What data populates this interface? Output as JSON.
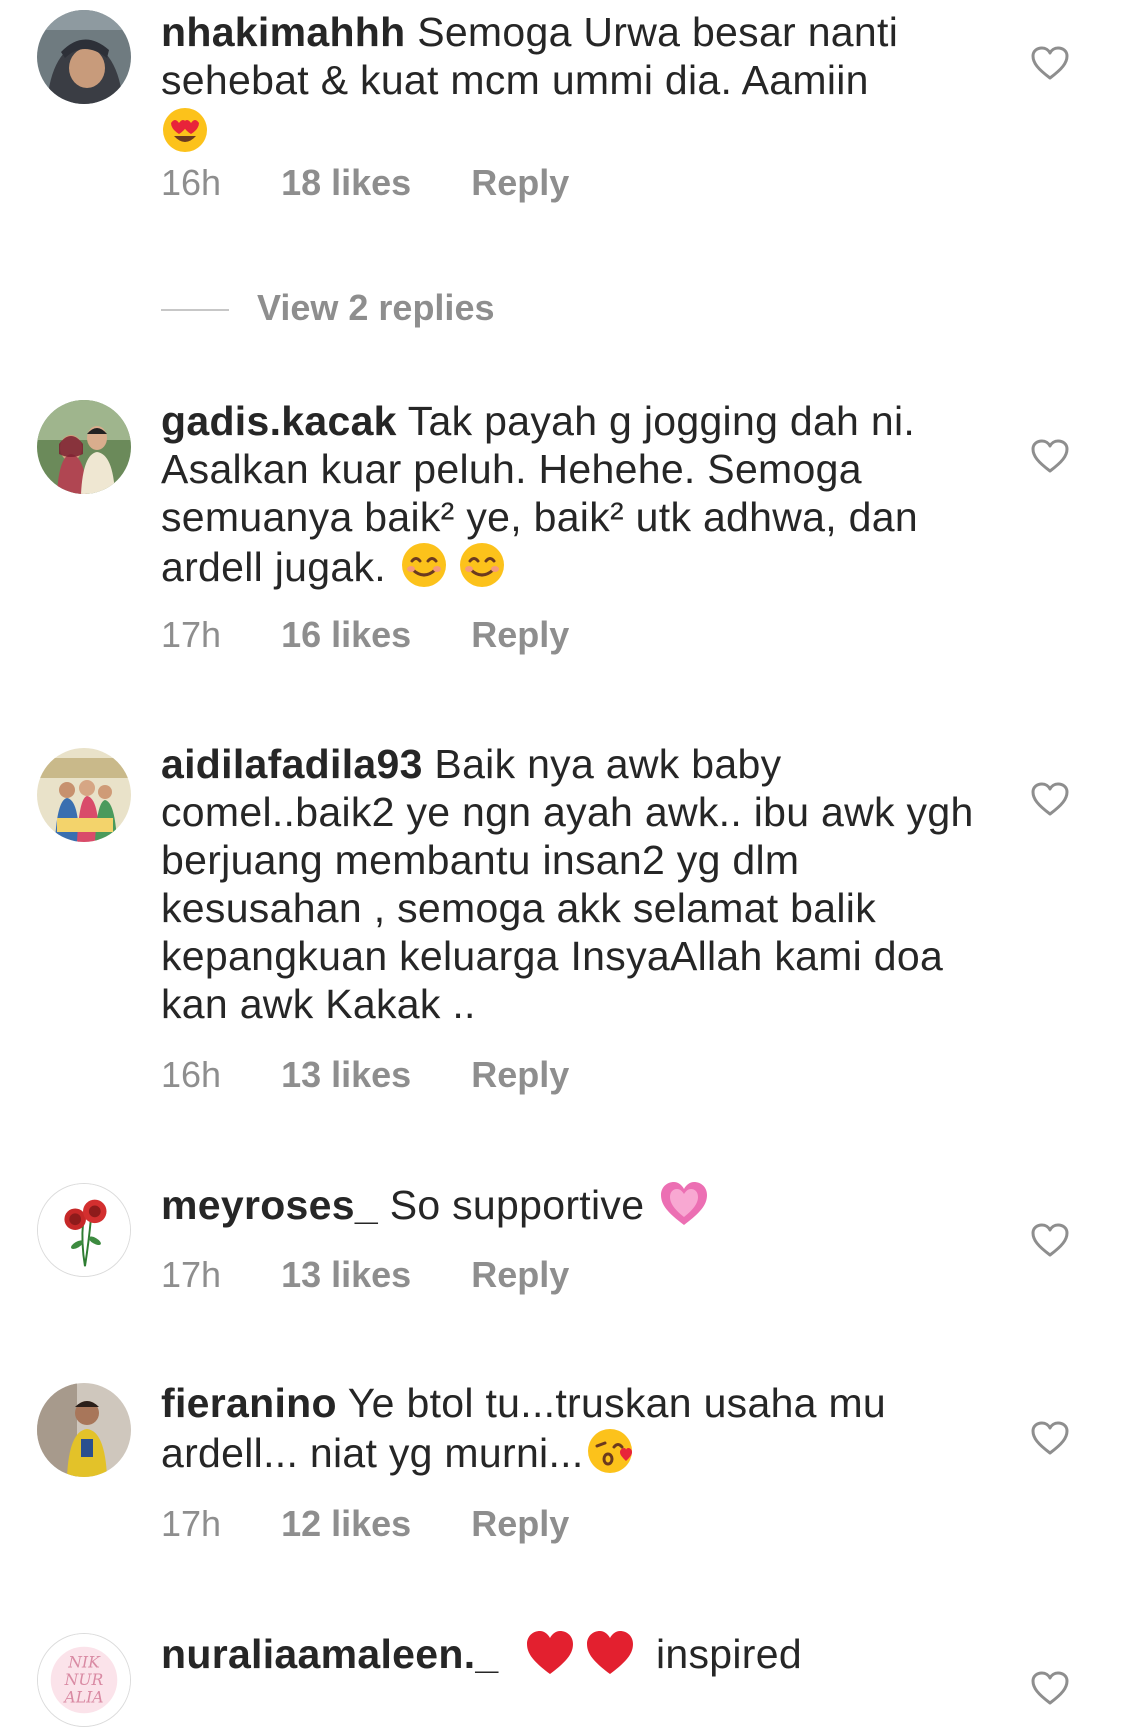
{
  "comments": [
    {
      "username": "nhakimahhh",
      "text": "Semoga Urwa besar nanti sehebat & kuat mcm ummi dia. Aamiin",
      "emoji": "heart-eyes-emoji",
      "time": "16h",
      "likes": "18 likes",
      "reply": "Reply"
    },
    {
      "username": "gadis.kacak",
      "text": "Tak payah g jogging dah ni. Asalkan kuar peluh. Hehehe. Semoga semuanya baik² ye, baik² utk adhwa, dan ardell jugak.",
      "emoji": "smiling-emoji x2",
      "time": "17h",
      "likes": "16 likes",
      "reply": "Reply"
    },
    {
      "username": "aidilafadila93",
      "text": "Baik nya awk baby comel..baik2 ye ngn ayah awk.. ibu awk ygh berjuang membantu insan2 yg dlm kesusahan , semoga akk selamat balik kepangkuan keluarga InsyaAllah kami doa kan awk Kakak ..",
      "time": "16h",
      "likes": "13 likes",
      "reply": "Reply"
    },
    {
      "username": "meyroses_",
      "text": "So supportive",
      "emoji": "sparkling-heart-emoji",
      "time": "17h",
      "likes": "13 likes",
      "reply": "Reply"
    },
    {
      "username": "fieranino",
      "text": "Ye btol tu...truskan usaha mu ardell... niat yg murni...",
      "emoji": "kissing-wink-emoji",
      "time": "17h",
      "likes": "12 likes",
      "reply": "Reply"
    },
    {
      "username": "nuraliaamaleen._",
      "text_after_emoji": "inspired",
      "emoji": "red-heart-emoji x2"
    }
  ],
  "view_replies": "View 2 replies",
  "avatar_text": "NIK NUR ALIA",
  "colors": {
    "text_primary": "#262626",
    "text_secondary": "#8e8e8e",
    "divider": "#c7c7c7",
    "background": "#ffffff"
  },
  "icons": {
    "like": "heart-outline-icon"
  }
}
